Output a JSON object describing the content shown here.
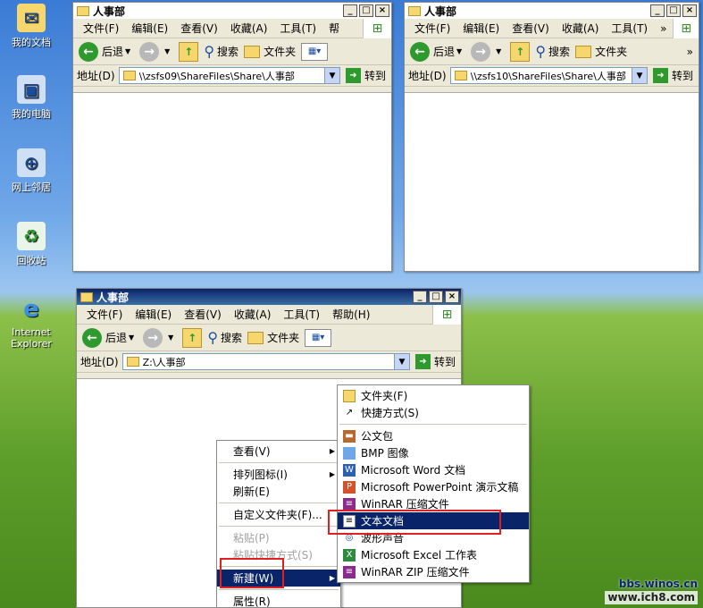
{
  "desktop_icons": [
    {
      "label": "我的文档"
    },
    {
      "label": "我的电脑"
    },
    {
      "label": "网上邻居"
    },
    {
      "label": "回收站"
    },
    {
      "label": "Internet Explorer"
    }
  ],
  "window1": {
    "title": "人事部",
    "menus": [
      "文件(F)",
      "编辑(E)",
      "查看(V)",
      "收藏(A)",
      "工具(T)",
      "帮"
    ],
    "toolbar": {
      "back": "后退",
      "search": "搜索",
      "folders": "文件夹"
    },
    "address_label": "地址(D)",
    "address_value": "\\\\zsfs09\\ShareFiles\\Share\\人事部",
    "go_label": "转到"
  },
  "window2": {
    "title": "人事部",
    "menus": [
      "文件(F)",
      "编辑(E)",
      "查看(V)",
      "收藏(A)",
      "工具(T)"
    ],
    "toolbar": {
      "back": "后退",
      "search": "搜索",
      "folders": "文件夹"
    },
    "address_label": "地址(D)",
    "address_value": "\\\\zsfs10\\ShareFiles\\Share\\人事部",
    "go_label": "转到"
  },
  "window3": {
    "title": "人事部",
    "menus": [
      "文件(F)",
      "编辑(E)",
      "查看(V)",
      "收藏(A)",
      "工具(T)",
      "帮助(H)"
    ],
    "toolbar": {
      "back": "后退",
      "search": "搜索",
      "folders": "文件夹"
    },
    "address_label": "地址(D)",
    "address_value": "Z:\\人事部",
    "go_label": "转到"
  },
  "context_menu": {
    "view": "查看(V)",
    "arrange": "排列图标(I)",
    "refresh": "刷新(E)",
    "customize": "自定义文件夹(F)...",
    "paste": "粘贴(P)",
    "paste_shortcut": "粘贴快捷方式(S)",
    "new": "新建(W)",
    "properties": "属性(R)"
  },
  "submenu": {
    "folder": "文件夹(F)",
    "shortcut": "快捷方式(S)",
    "briefcase": "公文包",
    "bmp": "BMP 图像",
    "word": "Microsoft Word 文档",
    "ppt": "Microsoft PowerPoint 演示文稿",
    "winrar": "WinRAR 压缩文件",
    "text": "文本文档",
    "wave": "波形声音",
    "excel": "Microsoft Excel 工作表",
    "winrar_zip": "WinRAR ZIP 压缩文件"
  },
  "watermark": {
    "line1": "bbs.winos.cn",
    "line2": "www.ich8.com"
  }
}
